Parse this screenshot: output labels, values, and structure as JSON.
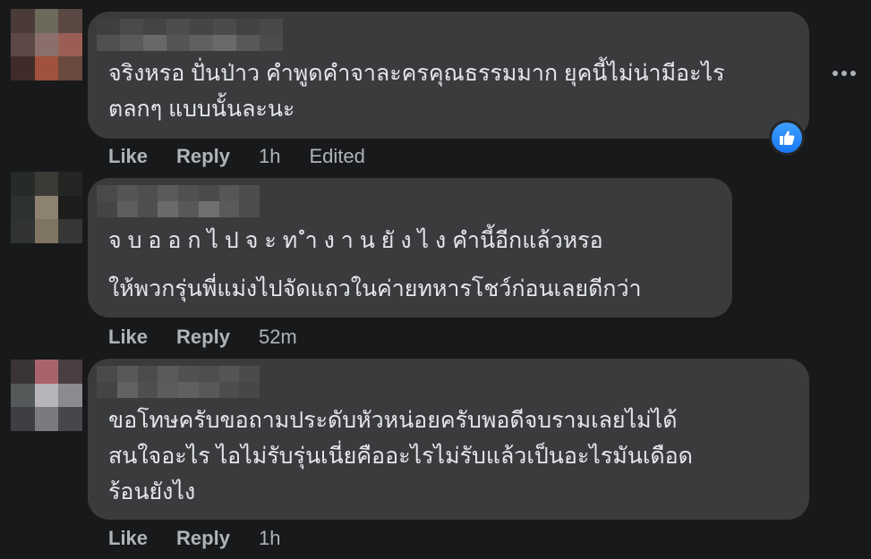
{
  "colors": {
    "background": "#18191a",
    "bubble": "#3a3b3c",
    "text": "#e4e6eb",
    "secondary_text": "#b0b3b8",
    "like_blue": "#1877f2"
  },
  "comments": [
    {
      "text_lines": [
        "จริงหรอ ปั่นป่าว คำพูดคำจาละครคุณธรรมมาก ยุคนี้ไม่น่ามีอะไร",
        "ตลกๆ แบบนั้นละนะ"
      ],
      "like_label": "Like",
      "reply_label": "Reply",
      "time": "1h",
      "edited": "Edited",
      "reaction_icon": "thumbs-up-icon",
      "more_icon": "more-options-icon"
    },
    {
      "text_lines": [
        "จ บ อ อ ก ไ ป จ ะ ท ำ ง า น ยั ง ไ ง คำนี้อีกแล้วหรอ",
        "ให้พวกรุ่นพี่แม่งไปจัดแถวในค่ายทหารโชว์ก่อนเลยดีกว่า"
      ],
      "like_label": "Like",
      "reply_label": "Reply",
      "time": "52m"
    },
    {
      "text_lines": [
        "ขอโทษครับขอถามประดับหัวหน่อยครับพอดีจบรามเลยไม่ได้",
        "สนใจอะไร ไอไม่รับรุ่นเนี่ยคืออะไรไม่รับแล้วเป็นอะไรมันเดือด",
        "ร้อนยังไง"
      ],
      "like_label": "Like",
      "reply_label": "Reply",
      "time": "1h"
    }
  ]
}
